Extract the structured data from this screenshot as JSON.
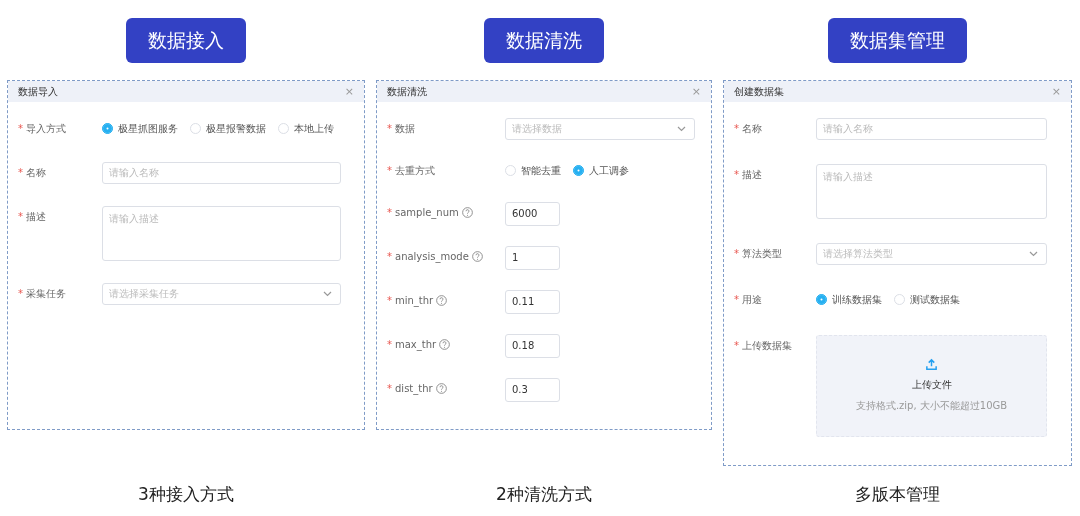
{
  "sections": [
    {
      "heading": "数据接入",
      "caption": "3种接入方式",
      "dialog": {
        "title": "数据导入",
        "close": "×",
        "fields": [
          {
            "kind": "radio",
            "marker": "*",
            "label": "导入方式",
            "options": [
              {
                "label": "极星抓图服务",
                "selected": true
              },
              {
                "label": "极星报警数据",
                "selected": false
              },
              {
                "label": "本地上传",
                "selected": false
              }
            ]
          },
          {
            "kind": "input",
            "marker": "*",
            "label": "名称",
            "placeholder": "请输入名称"
          },
          {
            "kind": "textarea",
            "marker": "*",
            "label": "描述",
            "placeholder": "请输入描述"
          },
          {
            "kind": "select",
            "marker": "*",
            "label": "采集任务",
            "placeholder": "请选择采集任务"
          }
        ]
      }
    },
    {
      "heading": "数据清洗",
      "caption": "2种清洗方式",
      "dialog": {
        "title": "数据清洗",
        "close": "×",
        "fields": [
          {
            "kind": "select",
            "marker": "*",
            "label": "数据",
            "placeholder": "请选择数据"
          },
          {
            "kind": "radio",
            "marker": "*",
            "label": "去重方式",
            "options": [
              {
                "label": "智能去重",
                "selected": false
              },
              {
                "label": "人工调参",
                "selected": true
              }
            ]
          },
          {
            "kind": "number",
            "marker": "*",
            "label": "sample_num",
            "help": true,
            "value": "6000"
          },
          {
            "kind": "number",
            "marker": "*",
            "label": "analysis_mode",
            "help": true,
            "value": "1"
          },
          {
            "kind": "number",
            "marker": "*",
            "label": "min_thr",
            "help": true,
            "value": "0.11"
          },
          {
            "kind": "number",
            "marker": "*",
            "label": "max_thr",
            "help": true,
            "value": "0.18"
          },
          {
            "kind": "number",
            "marker": "*",
            "label": "dist_thr",
            "help": true,
            "value": "0.3"
          }
        ]
      }
    },
    {
      "heading": "数据集管理",
      "caption": "多版本管理",
      "dialog": {
        "title": "创建数据集",
        "close": "×",
        "fields": [
          {
            "kind": "input",
            "marker": "*",
            "label": "名称",
            "placeholder": "请输入名称"
          },
          {
            "kind": "textarea",
            "marker": "*",
            "label": "描述",
            "placeholder": "请输入描述"
          },
          {
            "kind": "select",
            "marker": "*",
            "label": "算法类型",
            "placeholder": "请选择算法类型"
          },
          {
            "kind": "radio",
            "marker": "*",
            "label": "用途",
            "options": [
              {
                "label": "训练数据集",
                "selected": true
              },
              {
                "label": "测试数据集",
                "selected": false
              }
            ]
          },
          {
            "kind": "upload",
            "marker": "*",
            "label": "上传数据集",
            "title": "上传文件",
            "hint": "支持格式.zip, 大小不能超过10GB"
          }
        ]
      }
    }
  ]
}
